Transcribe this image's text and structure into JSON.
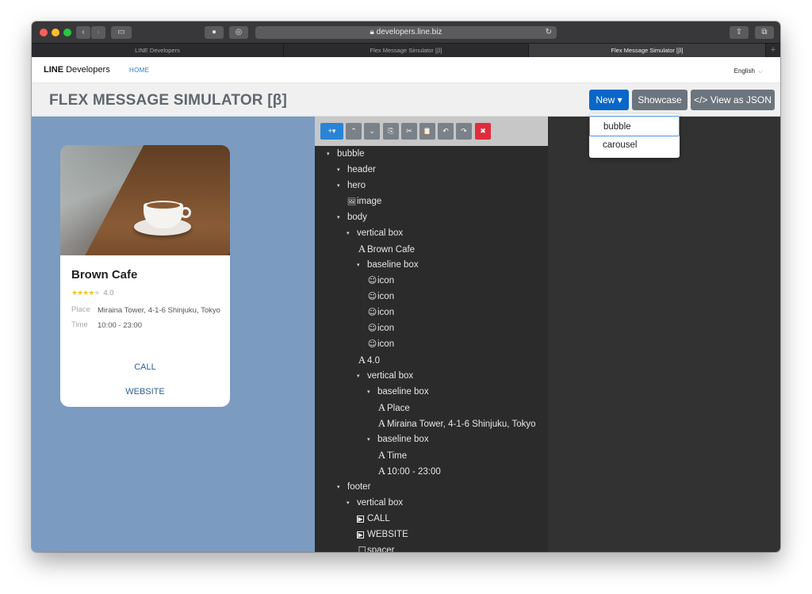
{
  "browser": {
    "url": "developers.line.biz",
    "tabs": [
      "LINE Developers",
      "Flex Message Simulator [β]",
      "Flex Message Simulator [β]"
    ],
    "tab_plus": "+",
    "reload_icon": "↻"
  },
  "sitenav": {
    "brand_bold": "LINE",
    "brand_rest": "Developers",
    "home": "HOME",
    "language": "English",
    "chevron": "⌵"
  },
  "header": {
    "title": "FLEX MESSAGE SIMULATOR [β]",
    "new_label": "New ▾",
    "showcase_label": "Showcase",
    "json_label": "</> View as JSON"
  },
  "dropdown": {
    "items": [
      "bubble",
      "carousel"
    ],
    "selected": "bubble"
  },
  "card": {
    "name": "Brown Cafe",
    "stars": "★★★★",
    "star_off": "★",
    "rating": "4.0",
    "place_label": "Place",
    "place_value": "Miraina Tower, 4-1-6 Shinjuku, Tokyo",
    "time_label": "Time",
    "time_value": "10:00 - 23:00",
    "call": "CALL",
    "website": "WEBSITE"
  },
  "toolbar": {
    "add": "+▾",
    "up": "⌃",
    "down": "⌄",
    "copy": "⎘",
    "cut": "✂",
    "paste": "📋",
    "undo": "↶",
    "redo": "↷",
    "delete": "✖"
  },
  "tree": [
    {
      "label": "bubble",
      "icon": "caret"
    },
    {
      "label": "header",
      "icon": "caret"
    },
    {
      "label": "hero",
      "icon": "caret"
    },
    {
      "label": "image",
      "icon": "image"
    },
    {
      "label": "body",
      "icon": "caret"
    },
    {
      "label": "vertical box",
      "icon": "caret"
    },
    {
      "label": "Brown Cafe",
      "icon": "text"
    },
    {
      "label": "baseline box",
      "icon": "caret"
    },
    {
      "label": "icon",
      "icon": "smiley"
    },
    {
      "label": "icon",
      "icon": "smiley"
    },
    {
      "label": "icon",
      "icon": "smiley"
    },
    {
      "label": "icon",
      "icon": "smiley"
    },
    {
      "label": "icon",
      "icon": "smiley"
    },
    {
      "label": "4.0",
      "icon": "text"
    },
    {
      "label": "vertical box",
      "icon": "caret"
    },
    {
      "label": "baseline box",
      "icon": "caret"
    },
    {
      "label": "Place",
      "icon": "text"
    },
    {
      "label": "Miraina Tower, 4-1-6 Shinjuku, Tokyo",
      "icon": "text"
    },
    {
      "label": "baseline box",
      "icon": "caret"
    },
    {
      "label": "Time",
      "icon": "text"
    },
    {
      "label": "10:00 - 23:00",
      "icon": "text"
    },
    {
      "label": "footer",
      "icon": "caret"
    },
    {
      "label": "vertical box",
      "icon": "caret"
    },
    {
      "label": "CALL",
      "icon": "button"
    },
    {
      "label": "WEBSITE",
      "icon": "button"
    },
    {
      "label": "spacer",
      "icon": "spacer"
    }
  ],
  "colors": {
    "preview_bg": "#7b9bc1",
    "primary": "#0a66c8",
    "secondary": "#6b757e",
    "tree_bg": "#2b2b2b",
    "star": "#f5c518",
    "link": "#2e5f96"
  }
}
